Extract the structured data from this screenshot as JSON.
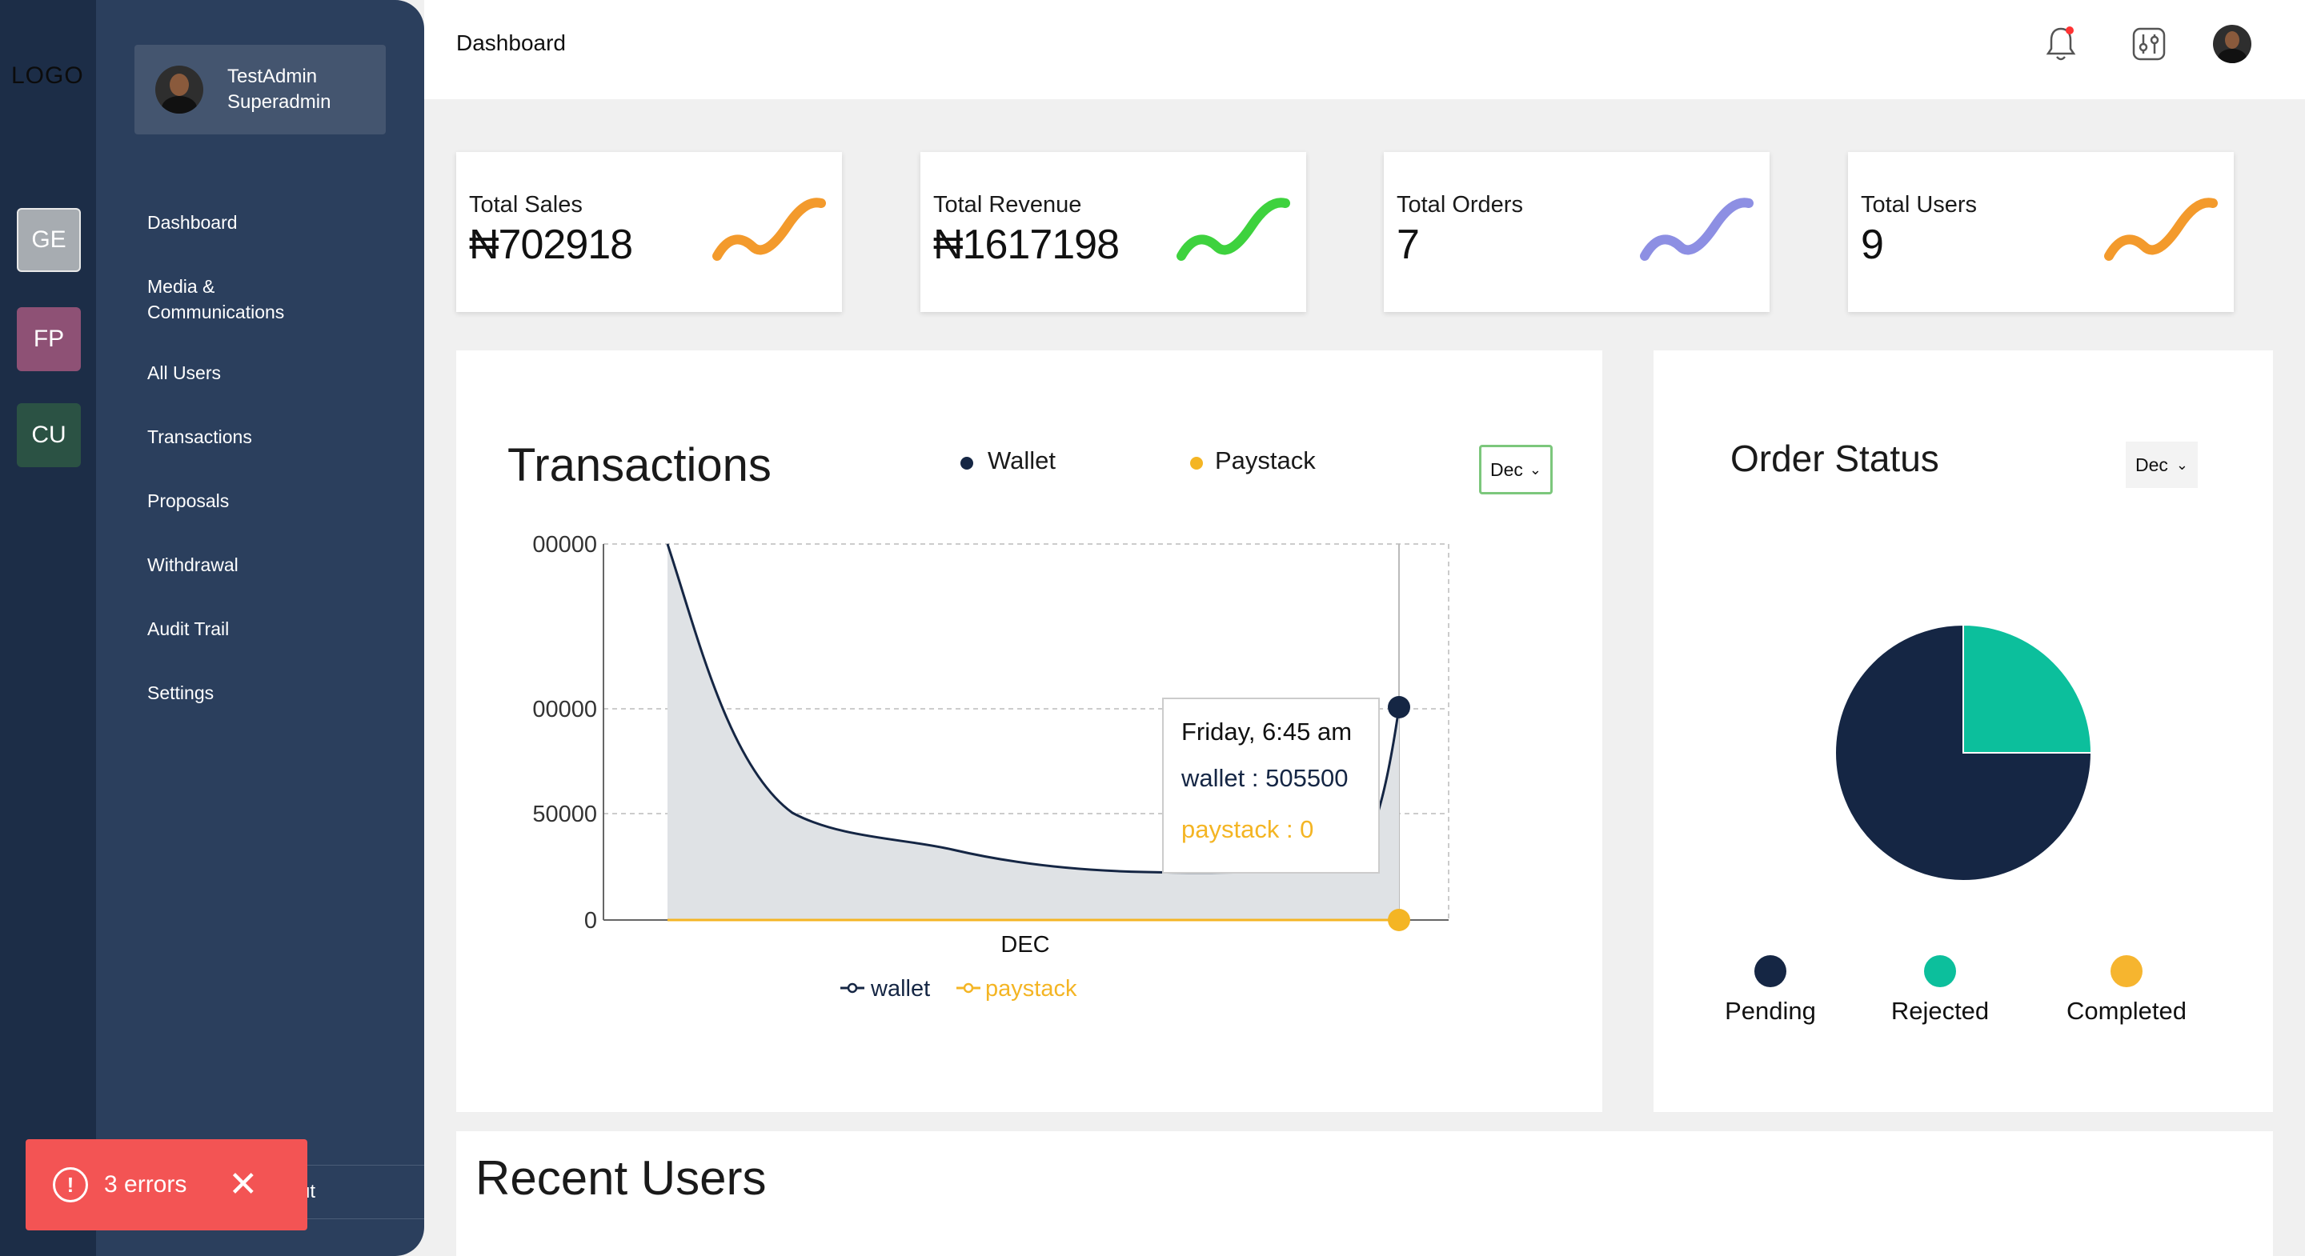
{
  "rail": {
    "logo": "LOGO",
    "workspaces": [
      {
        "label": "GE",
        "color": "#a7acb1"
      },
      {
        "label": "FP",
        "color": "#8e5175"
      },
      {
        "label": "CU",
        "color": "#2b5244"
      }
    ]
  },
  "profile": {
    "name": "TestAdmin",
    "role": "Superadmin"
  },
  "nav": {
    "items": [
      "Dashboard",
      "Media &",
      "Communications",
      "All Users",
      "Transactions",
      "Proposals",
      "Withdrawal",
      "Audit Trail",
      "Settings"
    ],
    "logout": "ut"
  },
  "toast": {
    "text": "3 errors"
  },
  "header": {
    "title": "Dashboard"
  },
  "stats": [
    {
      "label": "Total Sales",
      "value": "₦702918",
      "color": "#f39a2c"
    },
    {
      "label": "Total Revenue",
      "value": "₦1617198",
      "color": "#3ed23e"
    },
    {
      "label": "Total Orders",
      "value": "7",
      "color": "#8d8fe3"
    },
    {
      "label": "Total Users",
      "value": "9",
      "color": "#f39a2c"
    }
  ],
  "transactions": {
    "title": "Transactions",
    "legend": [
      {
        "label": "Wallet",
        "color": "#152644"
      },
      {
        "label": "Paystack",
        "color": "#f4b524"
      }
    ],
    "month": "Dec",
    "tooltip": {
      "time": "Friday, 6:45 am",
      "wallet": "wallet : 505500",
      "paystack": "paystack : 0"
    },
    "bottom_legend": [
      "wallet",
      "paystack"
    ]
  },
  "chart_data": {
    "type": "area",
    "x": [
      "DEC"
    ],
    "ytick_labels": [
      "00000",
      "00000",
      "50000",
      "0"
    ],
    "series": [
      {
        "name": "wallet",
        "color": "#152644",
        "tooltip_value": 505500
      },
      {
        "name": "paystack",
        "color": "#f4b524",
        "tooltip_value": 0
      }
    ],
    "grid": true,
    "legend_position": "bottom"
  },
  "order_status": {
    "title": "Order Status",
    "month": "Dec",
    "slices": [
      {
        "label": "Pending",
        "value": 75,
        "color": "#152644"
      },
      {
        "label": "Rejected",
        "value": 25,
        "color": "#0cbf9c"
      },
      {
        "label": "Completed",
        "value": 0,
        "color": "#f6b52f"
      }
    ]
  },
  "recent_users": {
    "title": "Recent Users"
  }
}
